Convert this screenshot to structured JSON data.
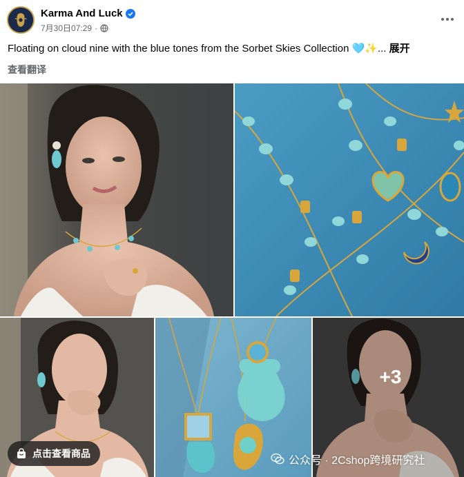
{
  "post": {
    "page_name": "Karma And Luck",
    "timestamp": "7月30日07:29",
    "separator": "·",
    "caption": "Floating on cloud nine with the blue tones from the Sorbet Skies Collection 🩵✨...",
    "see_more": "展开",
    "translate": "查看翻译"
  },
  "icons": {
    "verified": "verified-badge-icon",
    "privacy": "globe-icon",
    "more": "more-options-icon",
    "shop": "shopping-bag-icon",
    "watermark": "wechat-icon"
  },
  "gallery": {
    "more_count": "+3",
    "shop_button": "点击查看商品"
  },
  "watermark": {
    "text": "公众号 · 2Cshop跨境研究社"
  },
  "colors": {
    "link_blue": "#1877f2",
    "meta_gray": "#65676b",
    "turquoise": "#6fc7cf",
    "gold": "#d8a63a"
  }
}
